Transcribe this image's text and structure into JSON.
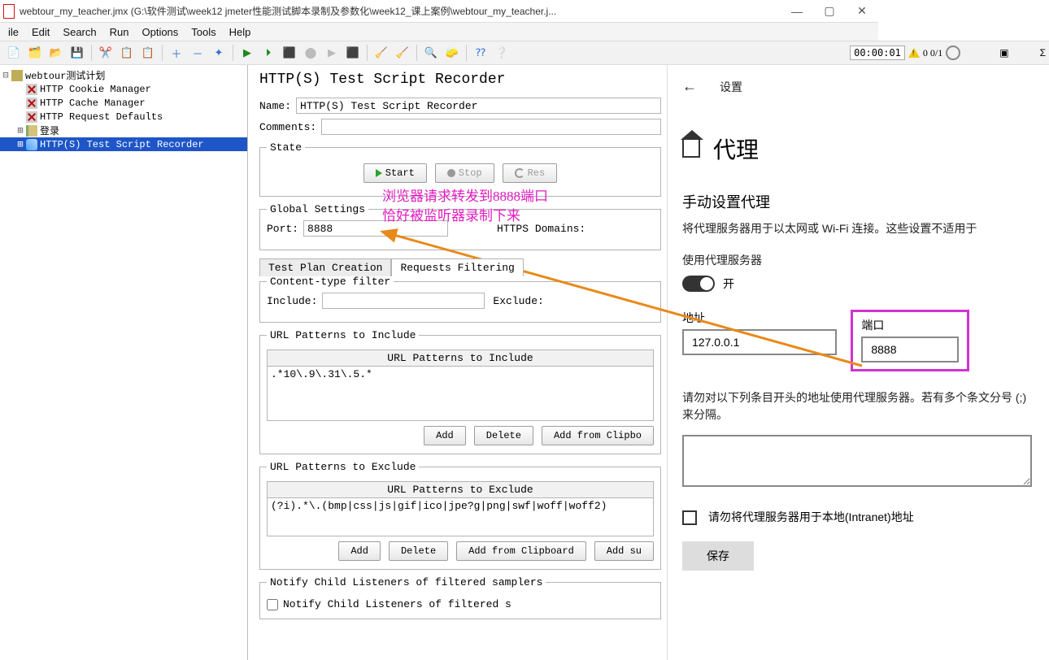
{
  "titlebar": {
    "text": "webtour_my_teacher.jmx (G:\\软件测试\\week12 jmeter性能测试脚本录制及参数化\\week12_课上案例\\webtour_my_teacher.j..."
  },
  "menu": {
    "items": [
      "ile",
      "Edit",
      "Search",
      "Run",
      "Options",
      "Tools",
      "Help"
    ]
  },
  "toolbar": {
    "timer": "00:00:01",
    "warn_counts": "0  0/1"
  },
  "tree": {
    "root": "webtour测试计划",
    "children": [
      "HTTP Cookie Manager",
      "HTTP Cache Manager",
      "HTTP Request Defaults",
      "登录",
      "HTTP(S) Test Script Recorder"
    ]
  },
  "recorder": {
    "title": "HTTP(S) Test Script Recorder",
    "name_label": "Name:",
    "name_value": "HTTP(S) Test Script Recorder",
    "comments_label": "Comments:",
    "comments_value": "",
    "state_legend": "State",
    "start_btn": "Start",
    "stop_btn": "Stop",
    "restart_btn": "Res",
    "global_legend": "Global Settings",
    "port_label": "Port:",
    "port_value": "8888",
    "https_label": "HTTPS Domains:",
    "tab_plan": "Test Plan Creation",
    "tab_filter": "Requests Filtering",
    "ct_legend": "Content-type filter",
    "include_label": "Include:",
    "include_value": "",
    "exclude_label": "Exclude:",
    "url_inc_legend": "URL Patterns to Include",
    "url_inc_head": "URL Patterns to Include",
    "url_inc_row0": ".*10\\.9\\.31\\.5.*",
    "url_exc_legend": "URL Patterns to Exclude",
    "url_exc_head": "URL Patterns to Exclude",
    "url_exc_row0": "(?i).*\\.(bmp|css|js|gif|ico|jpe?g|png|swf|woff|woff2)",
    "btn_add": "Add",
    "btn_delete": "Delete",
    "btn_add_clip": "Add from Clipbo",
    "btn_add_clip_full": "Add from Clipboard",
    "btn_add_su": "Add su",
    "notify_legend": "Notify Child Listeners of filtered samplers",
    "notify_check": "Notify Child Listeners of filtered s"
  },
  "settings": {
    "back": "←",
    "nav_title": "设置",
    "page_title": "代理",
    "section_manual": "手动设置代理",
    "desc1": "将代理服务器用于以太网或 Wi-Fi 连接。这些设置不适用于",
    "use_proxy_label": "使用代理服务器",
    "toggle_text": "开",
    "addr_label": "地址",
    "addr_value": "127.0.0.1",
    "port_label": "端口",
    "port_value": "8888",
    "bypass_desc": "请勿对以下列条目开头的地址使用代理服务器。若有多个条文分号 (;) 来分隔。",
    "intranet_check": "请勿将代理服务器用于本地(Intranet)地址",
    "save_btn": "保存"
  },
  "annotation": {
    "line1": "浏览器请求转发到8888端口",
    "line2": "恰好被监听器录制下来"
  }
}
